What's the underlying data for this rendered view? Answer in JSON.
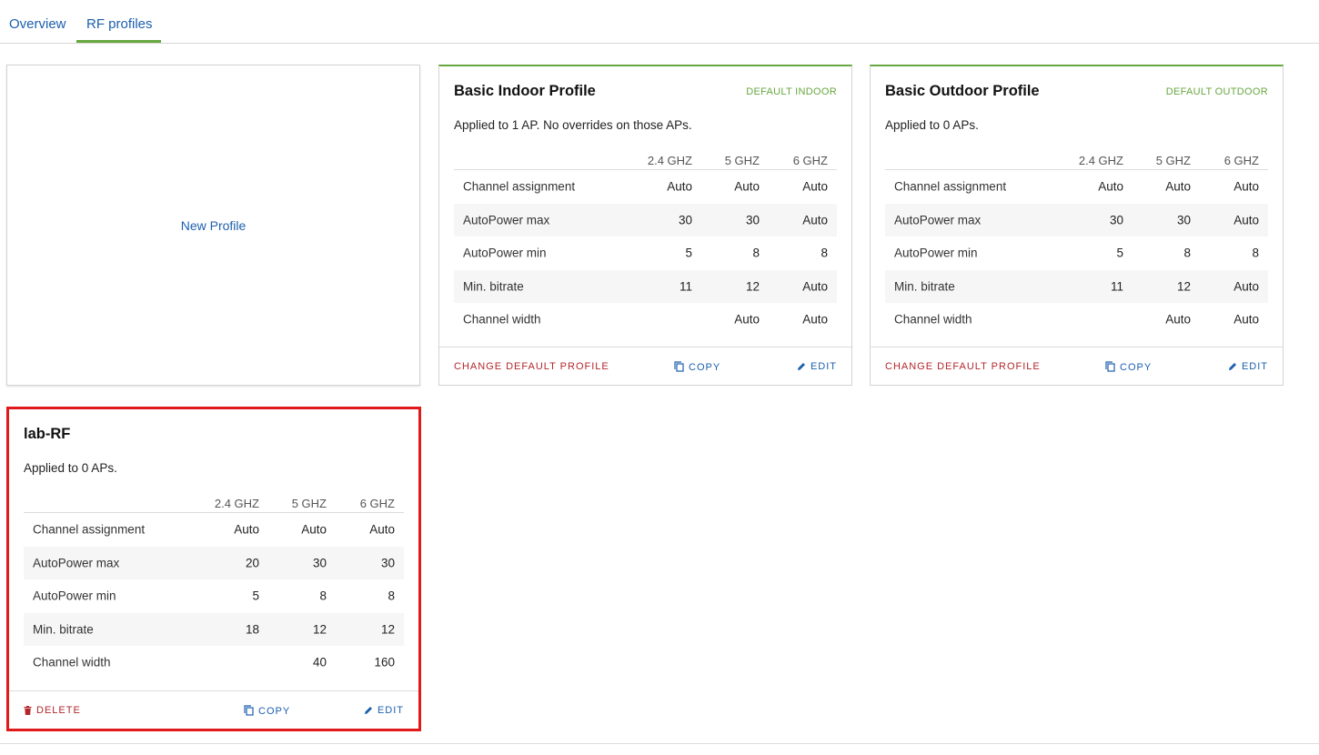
{
  "tabs": [
    {
      "label": "Overview",
      "active": false
    },
    {
      "label": "RF profiles",
      "active": true
    }
  ],
  "new_profile": {
    "label": "New Profile"
  },
  "table_headers": [
    "2.4 GHZ",
    "5 GHZ",
    "6 GHZ"
  ],
  "profiles": [
    {
      "title": "Basic Indoor Profile",
      "badge": "DEFAULT INDOOR",
      "applied": "Applied to 1 AP. No overrides on those APs.",
      "rows": [
        {
          "label": "Channel assignment",
          "v": [
            "Auto",
            "Auto",
            "Auto"
          ]
        },
        {
          "label": "AutoPower max",
          "v": [
            "30",
            "30",
            "Auto"
          ]
        },
        {
          "label": "AutoPower min",
          "v": [
            "5",
            "8",
            "8"
          ]
        },
        {
          "label": "Min. bitrate",
          "v": [
            "11",
            "12",
            "Auto"
          ]
        },
        {
          "label": "Channel width",
          "v": [
            "",
            "Auto",
            "Auto"
          ]
        }
      ],
      "actions": {
        "left": "CHANGE DEFAULT PROFILE",
        "copy": "COPY",
        "edit": "EDIT"
      }
    },
    {
      "title": "Basic Outdoor Profile",
      "badge": "DEFAULT OUTDOOR",
      "applied": "Applied to 0 APs.",
      "rows": [
        {
          "label": "Channel assignment",
          "v": [
            "Auto",
            "Auto",
            "Auto"
          ]
        },
        {
          "label": "AutoPower max",
          "v": [
            "30",
            "30",
            "Auto"
          ]
        },
        {
          "label": "AutoPower min",
          "v": [
            "5",
            "8",
            "8"
          ]
        },
        {
          "label": "Min. bitrate",
          "v": [
            "11",
            "12",
            "Auto"
          ]
        },
        {
          "label": "Channel width",
          "v": [
            "",
            "Auto",
            "Auto"
          ]
        }
      ],
      "actions": {
        "left": "CHANGE DEFAULT PROFILE",
        "copy": "COPY",
        "edit": "EDIT"
      }
    },
    {
      "title": "lab-RF",
      "applied": "Applied to 0 APs.",
      "rows": [
        {
          "label": "Channel assignment",
          "v": [
            "Auto",
            "Auto",
            "Auto"
          ]
        },
        {
          "label": "AutoPower max",
          "v": [
            "20",
            "30",
            "30"
          ]
        },
        {
          "label": "AutoPower min",
          "v": [
            "5",
            "8",
            "8"
          ]
        },
        {
          "label": "Min. bitrate",
          "v": [
            "18",
            "12",
            "12"
          ]
        },
        {
          "label": "Channel width",
          "v": [
            "",
            "40",
            "160"
          ]
        }
      ],
      "actions": {
        "left": "DELETE",
        "copy": "COPY",
        "edit": "EDIT"
      }
    }
  ],
  "colors": {
    "accent_green": "#67a73f",
    "link_blue": "#1c5fae",
    "danger_red": "#b3262b",
    "highlight_red": "#e0191b"
  }
}
